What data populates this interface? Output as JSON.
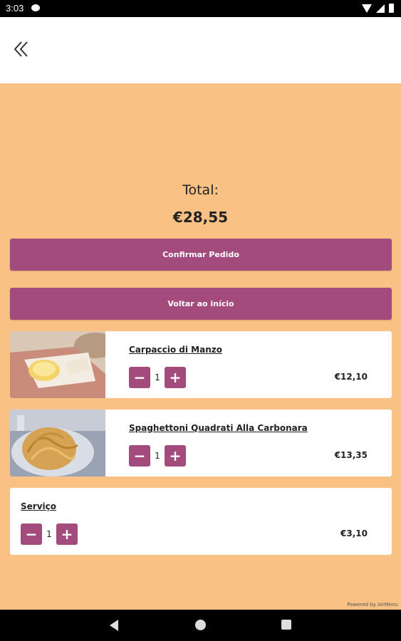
{
  "status_bar": {
    "time": "3:03"
  },
  "order": {
    "total_label": "Total:",
    "total_value": "€28,55",
    "confirm_label": "Confirmar Pedido",
    "home_label": "Voltar ao início"
  },
  "items": [
    {
      "name": "Carpaccio di Manzo",
      "qty": "1",
      "price": "€12,10",
      "image": "carpaccio-image"
    },
    {
      "name": "Spaghettoni Quadrati Alla Carbonara",
      "qty": "1",
      "price": "€13,35",
      "image": "carbonara-image"
    },
    {
      "name": "Serviço",
      "qty": "1",
      "price": "€3,10"
    }
  ],
  "footer": {
    "powered": "Powered by AirMenu"
  },
  "colors": {
    "background": "#f9c184",
    "accent": "#a34b7d"
  },
  "icons": {
    "back": "double-chevron-left-icon",
    "minus": "minus-icon",
    "plus": "plus-icon"
  }
}
